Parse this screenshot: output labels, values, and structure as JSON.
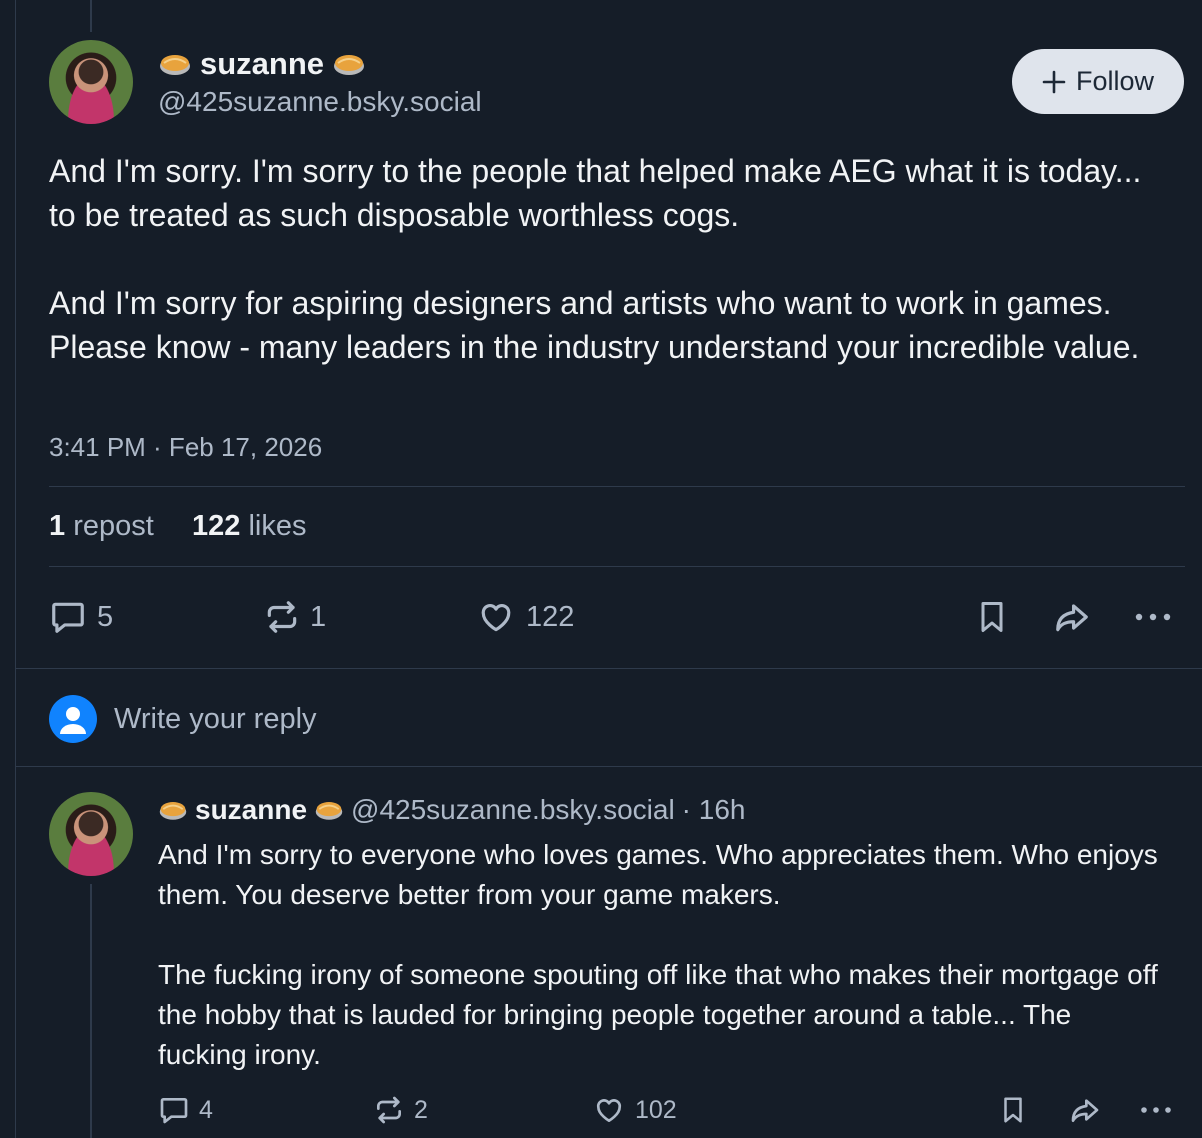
{
  "post": {
    "display_name": "suzanne",
    "handle": "@425suzanne.bsky.social",
    "follow_label": "Follow",
    "paragraph_1": "And I'm sorry. I'm sorry to the people that helped make AEG what it is today... to be treated as such disposable worthless cogs.",
    "paragraph_2": "And I'm sorry for aspiring designers and artists who want to work in games. Please know - many leaders in the industry understand your incredible value.",
    "timestamp": "3:41 PM · Feb 17, 2026",
    "stats": {
      "repost_count": "1",
      "repost_label": "repost",
      "like_count": "122",
      "like_label": "likes"
    },
    "actions": {
      "replies": "5",
      "reposts": "1",
      "likes": "122"
    }
  },
  "composer": {
    "placeholder": "Write your reply"
  },
  "reply": {
    "display_name": "suzanne",
    "handle": "@425suzanne.bsky.social",
    "time": "· 16h",
    "paragraph_1": "And I'm sorry to everyone who loves games. Who appreciates them. Who enjoys them. You deserve better from your game makers.",
    "paragraph_2": "The fucking irony of someone spouting off like that who makes their mortgage off the hobby that is lauded for bringing people together around a table... The fucking irony.",
    "actions": {
      "replies": "4",
      "reposts": "2",
      "likes": "102"
    }
  },
  "icons": {
    "name_emoji": "pie-icon",
    "reply": "speech-bubble-icon",
    "repost": "repost-arrows-icon",
    "like": "heart-icon",
    "bookmark": "bookmark-icon",
    "share": "share-arrow-icon",
    "more": "ellipsis-icon",
    "follow": "plus-icon",
    "composer_avatar": "default-user-icon"
  },
  "colors": {
    "background": "#151d28",
    "text": "#f1f3f5",
    "muted": "#aeb9c8",
    "divider": "#2e3a4b",
    "follow_button_bg": "#dfe4ec",
    "accent_blue": "#1083fe"
  }
}
